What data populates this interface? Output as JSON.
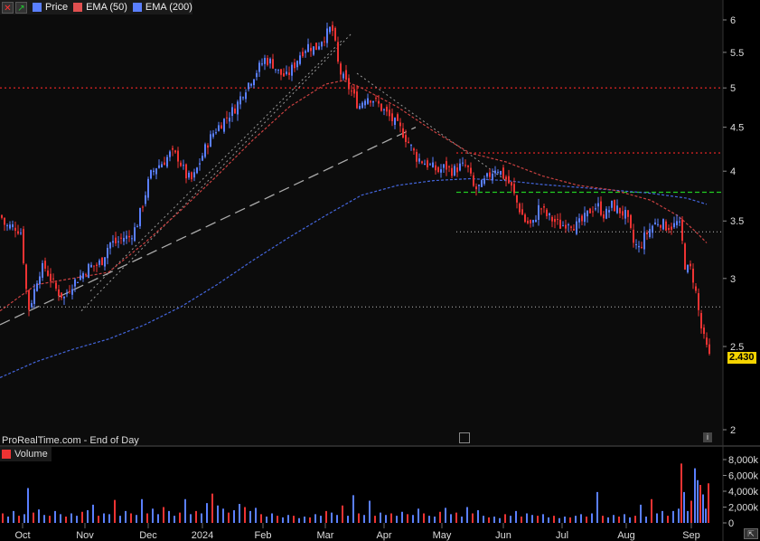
{
  "legend": {
    "series": [
      {
        "label": "Price",
        "color": "#5a7fff"
      },
      {
        "label": "EMA (50)",
        "color": "#e05050"
      },
      {
        "label": "EMA (200)",
        "color": "#5a7fff"
      }
    ]
  },
  "source_label": "ProRealTime.com - End of Day",
  "volume_label": "Volume",
  "last_price": "2.430",
  "colors": {
    "up": "#5a7fff",
    "down": "#ee3333",
    "ema50": "#c84040",
    "ema200": "#4466dd",
    "resistance": "#cc2222",
    "support": "#22cc22"
  },
  "chart_data": {
    "type": "candlestick",
    "x_ticks": [
      "Oct",
      "Nov",
      "Dec",
      "2024",
      "Feb",
      "Mar",
      "Apr",
      "May",
      "Jun",
      "Jul",
      "Aug",
      "Sep"
    ],
    "y_ticks": [
      "6",
      "5.5",
      "5",
      "4.5",
      "4",
      "3.5",
      "3",
      "2.5",
      "2"
    ],
    "volume_ticks": [
      "8,000k",
      "6,000k",
      "4,000k",
      "2,000k",
      "0"
    ],
    "price_axis": {
      "scale": "log",
      "min": 2.0,
      "max": 6.0
    },
    "volume_axis": {
      "min": 0,
      "max": 8000
    },
    "close_path": [
      [
        0,
        3.55
      ],
      [
        5,
        3.45
      ],
      [
        15,
        3.45
      ],
      [
        22,
        3.4
      ],
      [
        30,
        2.75
      ],
      [
        35,
        2.85
      ],
      [
        42,
        3.05
      ],
      [
        48,
        3.1
      ],
      [
        55,
        3.0
      ],
      [
        62,
        2.9
      ],
      [
        70,
        2.85
      ],
      [
        78,
        2.95
      ],
      [
        85,
        3.0
      ],
      [
        92,
        3.05
      ],
      [
        98,
        3.1
      ],
      [
        105,
        3.1
      ],
      [
        112,
        3.15
      ],
      [
        120,
        3.3
      ],
      [
        128,
        3.3
      ],
      [
        135,
        3.35
      ],
      [
        142,
        3.35
      ],
      [
        150,
        3.45
      ],
      [
        158,
        3.7
      ],
      [
        165,
        3.95
      ],
      [
        172,
        4.05
      ],
      [
        180,
        4.1
      ],
      [
        188,
        4.2
      ],
      [
        196,
        4.15
      ],
      [
        205,
        3.95
      ],
      [
        212,
        3.9
      ],
      [
        220,
        4.1
      ],
      [
        228,
        4.3
      ],
      [
        236,
        4.45
      ],
      [
        244,
        4.55
      ],
      [
        252,
        4.65
      ],
      [
        260,
        4.75
      ],
      [
        268,
        4.95
      ],
      [
        276,
        5.1
      ],
      [
        284,
        5.25
      ],
      [
        292,
        5.4
      ],
      [
        300,
        5.35
      ],
      [
        308,
        5.2
      ],
      [
        316,
        5.15
      ],
      [
        324,
        5.3
      ],
      [
        332,
        5.5
      ],
      [
        340,
        5.6
      ],
      [
        348,
        5.55
      ],
      [
        355,
        5.7
      ],
      [
        362,
        5.8
      ],
      [
        366,
        5.9
      ],
      [
        370,
        5.6
      ],
      [
        374,
        5.25
      ],
      [
        380,
        5.1
      ],
      [
        388,
        4.95
      ],
      [
        396,
        4.75
      ],
      [
        404,
        4.9
      ],
      [
        412,
        4.85
      ],
      [
        420,
        4.75
      ],
      [
        428,
        4.65
      ],
      [
        436,
        4.55
      ],
      [
        444,
        4.45
      ],
      [
        452,
        4.3
      ],
      [
        460,
        4.15
      ],
      [
        468,
        4.1
      ],
      [
        476,
        4.05
      ],
      [
        484,
        4.0
      ],
      [
        492,
        4.05
      ],
      [
        500,
        4.0
      ],
      [
        508,
        4.05
      ],
      [
        516,
        4.05
      ],
      [
        524,
        3.8
      ],
      [
        532,
        3.85
      ],
      [
        540,
        3.95
      ],
      [
        548,
        4.05
      ],
      [
        556,
        3.95
      ],
      [
        564,
        3.85
      ],
      [
        572,
        3.65
      ],
      [
        580,
        3.5
      ],
      [
        588,
        3.45
      ],
      [
        596,
        3.65
      ],
      [
        604,
        3.55
      ],
      [
        612,
        3.5
      ],
      [
        620,
        3.45
      ],
      [
        628,
        3.5
      ],
      [
        636,
        3.45
      ],
      [
        644,
        3.5
      ],
      [
        652,
        3.6
      ],
      [
        660,
        3.65
      ],
      [
        668,
        3.55
      ],
      [
        676,
        3.65
      ],
      [
        684,
        3.6
      ],
      [
        692,
        3.55
      ],
      [
        700,
        3.3
      ],
      [
        706,
        3.25
      ],
      [
        712,
        3.35
      ],
      [
        720,
        3.45
      ],
      [
        728,
        3.5
      ],
      [
        736,
        3.45
      ],
      [
        744,
        3.45
      ],
      [
        750,
        3.5
      ],
      [
        754,
        3.3
      ],
      [
        758,
        3.05
      ],
      [
        762,
        3.1
      ],
      [
        766,
        3.0
      ],
      [
        770,
        2.85
      ],
      [
        774,
        2.65
      ],
      [
        778,
        2.55
      ],
      [
        782,
        2.47
      ],
      [
        784,
        2.43
      ]
    ],
    "ema50_path": [
      [
        0,
        2.75
      ],
      [
        40,
        2.95
      ],
      [
        80,
        3.0
      ],
      [
        120,
        3.05
      ],
      [
        160,
        3.3
      ],
      [
        200,
        3.6
      ],
      [
        240,
        3.95
      ],
      [
        280,
        4.35
      ],
      [
        320,
        4.75
      ],
      [
        360,
        5.05
      ],
      [
        380,
        5.1
      ],
      [
        400,
        5.0
      ],
      [
        440,
        4.75
      ],
      [
        480,
        4.45
      ],
      [
        520,
        4.2
      ],
      [
        560,
        4.1
      ],
      [
        600,
        3.95
      ],
      [
        640,
        3.85
      ],
      [
        680,
        3.8
      ],
      [
        720,
        3.7
      ],
      [
        750,
        3.55
      ],
      [
        770,
        3.4
      ],
      [
        782,
        3.3
      ]
    ],
    "ema200_path": [
      [
        0,
        2.3
      ],
      [
        40,
        2.4
      ],
      [
        80,
        2.48
      ],
      [
        120,
        2.55
      ],
      [
        160,
        2.65
      ],
      [
        200,
        2.78
      ],
      [
        240,
        2.95
      ],
      [
        280,
        3.15
      ],
      [
        320,
        3.35
      ],
      [
        360,
        3.55
      ],
      [
        400,
        3.75
      ],
      [
        440,
        3.85
      ],
      [
        480,
        3.9
      ],
      [
        520,
        3.92
      ],
      [
        560,
        3.9
      ],
      [
        600,
        3.86
      ],
      [
        640,
        3.83
      ],
      [
        680,
        3.8
      ],
      [
        720,
        3.77
      ],
      [
        760,
        3.72
      ],
      [
        782,
        3.66
      ]
    ],
    "trendlines": [
      {
        "style": "dashed-gray",
        "points": [
          [
            0,
            2.65
          ],
          [
            460,
            4.5
          ]
        ]
      },
      {
        "style": "dotted-gray",
        "points": [
          [
            90,
            2.75
          ],
          [
            390,
            5.8
          ]
        ]
      },
      {
        "style": "dotted-gray",
        "points": [
          [
            100,
            2.9
          ],
          [
            380,
            5.7
          ]
        ]
      },
      {
        "style": "dotted-gray",
        "points": [
          [
            395,
            5.2
          ],
          [
            560,
            3.9
          ]
        ]
      }
    ],
    "h_lines": [
      {
        "price": 5.0,
        "from": 0,
        "to": 800,
        "style": "resistance"
      },
      {
        "price": 4.2,
        "from": 505,
        "to": 800,
        "style": "resistance"
      },
      {
        "price": 3.78,
        "from": 505,
        "to": 800,
        "style": "support"
      },
      {
        "price": 3.4,
        "from": 505,
        "to": 800,
        "style": "white-dotted"
      },
      {
        "price": 2.78,
        "from": 0,
        "to": 800,
        "style": "white-dotted"
      }
    ],
    "volume": [
      [
        2,
        1200
      ],
      [
        8,
        800
      ],
      [
        14,
        1500
      ],
      [
        20,
        900
      ],
      [
        26,
        1100
      ],
      [
        30,
        4400
      ],
      [
        36,
        1300
      ],
      [
        42,
        1700
      ],
      [
        48,
        1000
      ],
      [
        54,
        900
      ],
      [
        60,
        1500
      ],
      [
        66,
        1100
      ],
      [
        72,
        800
      ],
      [
        78,
        1200
      ],
      [
        84,
        900
      ],
      [
        90,
        1400
      ],
      [
        96,
        1600
      ],
      [
        102,
        2300
      ],
      [
        108,
        900
      ],
      [
        114,
        1200
      ],
      [
        120,
        1100
      ],
      [
        126,
        2900
      ],
      [
        132,
        900
      ],
      [
        138,
        1500
      ],
      [
        144,
        1200
      ],
      [
        150,
        1000
      ],
      [
        156,
        3000
      ],
      [
        162,
        1200
      ],
      [
        168,
        1800
      ],
      [
        174,
        1100
      ],
      [
        180,
        2000
      ],
      [
        186,
        1500
      ],
      [
        192,
        900
      ],
      [
        198,
        1300
      ],
      [
        204,
        3000
      ],
      [
        210,
        1100
      ],
      [
        216,
        1500
      ],
      [
        222,
        1200
      ],
      [
        228,
        2500
      ],
      [
        234,
        3700
      ],
      [
        240,
        2200
      ],
      [
        246,
        1800
      ],
      [
        252,
        1300
      ],
      [
        258,
        1600
      ],
      [
        264,
        2400
      ],
      [
        270,
        2000
      ],
      [
        276,
        1500
      ],
      [
        282,
        1900
      ],
      [
        288,
        1100
      ],
      [
        294,
        800
      ],
      [
        300,
        1200
      ],
      [
        306,
        900
      ],
      [
        312,
        700
      ],
      [
        318,
        1000
      ],
      [
        324,
        900
      ],
      [
        330,
        600
      ],
      [
        336,
        800
      ],
      [
        342,
        700
      ],
      [
        348,
        1100
      ],
      [
        354,
        900
      ],
      [
        360,
        1500
      ],
      [
        366,
        1300
      ],
      [
        372,
        1000
      ],
      [
        378,
        2200
      ],
      [
        384,
        900
      ],
      [
        390,
        3500
      ],
      [
        396,
        1200
      ],
      [
        402,
        1000
      ],
      [
        408,
        2800
      ],
      [
        414,
        900
      ],
      [
        420,
        1300
      ],
      [
        426,
        1000
      ],
      [
        432,
        1200
      ],
      [
        438,
        900
      ],
      [
        444,
        1400
      ],
      [
        450,
        1100
      ],
      [
        456,
        1000
      ],
      [
        462,
        1800
      ],
      [
        468,
        1200
      ],
      [
        474,
        900
      ],
      [
        480,
        800
      ],
      [
        486,
        1400
      ],
      [
        492,
        1900
      ],
      [
        498,
        1100
      ],
      [
        504,
        1300
      ],
      [
        510,
        800
      ],
      [
        516,
        2000
      ],
      [
        522,
        1200
      ],
      [
        528,
        1600
      ],
      [
        534,
        900
      ],
      [
        540,
        700
      ],
      [
        546,
        800
      ],
      [
        552,
        600
      ],
      [
        558,
        1100
      ],
      [
        564,
        900
      ],
      [
        570,
        1500
      ],
      [
        576,
        800
      ],
      [
        582,
        1200
      ],
      [
        588,
        1000
      ],
      [
        594,
        900
      ],
      [
        600,
        1100
      ],
      [
        606,
        700
      ],
      [
        612,
        900
      ],
      [
        618,
        600
      ],
      [
        624,
        800
      ],
      [
        630,
        700
      ],
      [
        636,
        900
      ],
      [
        642,
        1100
      ],
      [
        648,
        800
      ],
      [
        654,
        1200
      ],
      [
        660,
        3900
      ],
      [
        666,
        900
      ],
      [
        672,
        700
      ],
      [
        678,
        1000
      ],
      [
        684,
        800
      ],
      [
        690,
        1100
      ],
      [
        696,
        700
      ],
      [
        702,
        900
      ],
      [
        708,
        2300
      ],
      [
        714,
        800
      ],
      [
        720,
        3000
      ],
      [
        726,
        1200
      ],
      [
        732,
        1500
      ],
      [
        738,
        900
      ],
      [
        744,
        1500
      ],
      [
        750,
        1800
      ],
      [
        753,
        7500
      ],
      [
        756,
        3900
      ],
      [
        760,
        1500
      ],
      [
        764,
        2800
      ],
      [
        768,
        6900
      ],
      [
        771,
        5400
      ],
      [
        774,
        4800
      ],
      [
        777,
        3600
      ],
      [
        780,
        1800
      ],
      [
        783,
        5000
      ]
    ]
  }
}
